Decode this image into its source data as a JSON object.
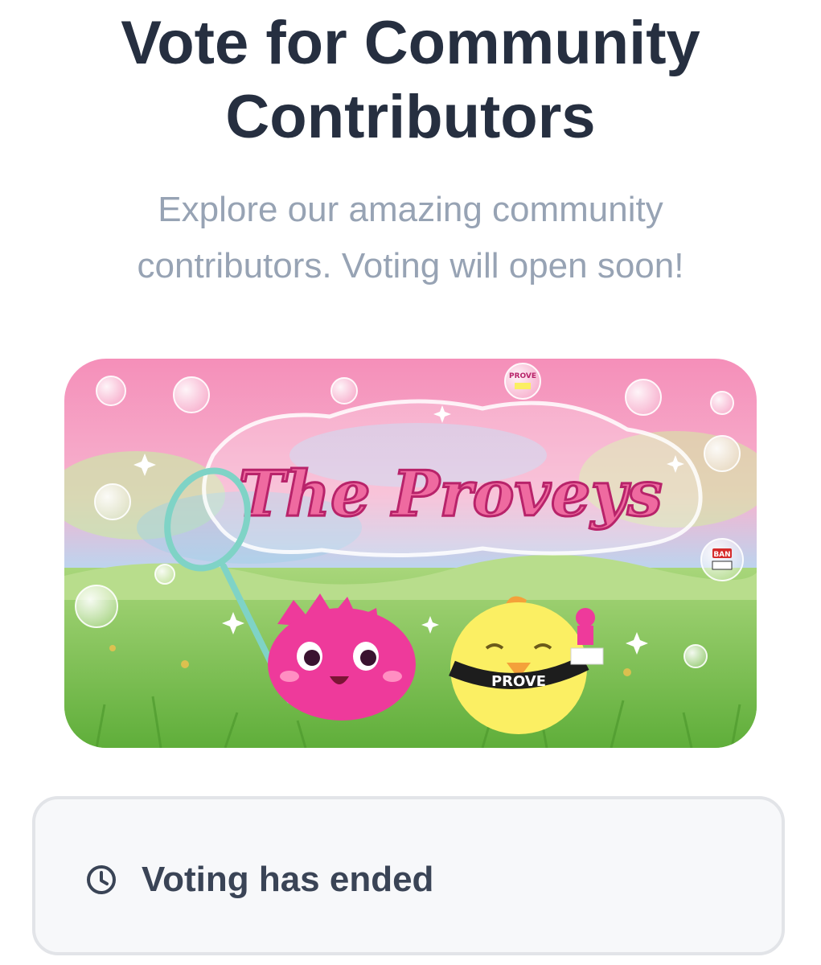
{
  "header": {
    "title": "Vote for Community Contributors",
    "subtitle": "Explore our amazing community contributors. Voting will open soon!"
  },
  "banner": {
    "heading": "The Proveys",
    "collar_text": "PROVE",
    "sticker_prove": "PROVE",
    "sticker_ban": "BAN"
  },
  "status": {
    "icon": "clock-icon",
    "text": "Voting has ended"
  },
  "colors": {
    "title": "#262f40",
    "subtitle": "#97a3b4",
    "card_bg": "#f7f8fa",
    "card_border": "#e2e4e8",
    "status_text": "#3a4456",
    "banner_pink": "#f6a3c3",
    "mascot_pink": "#ee3a9b",
    "mascot_yellow": "#fbef63"
  }
}
